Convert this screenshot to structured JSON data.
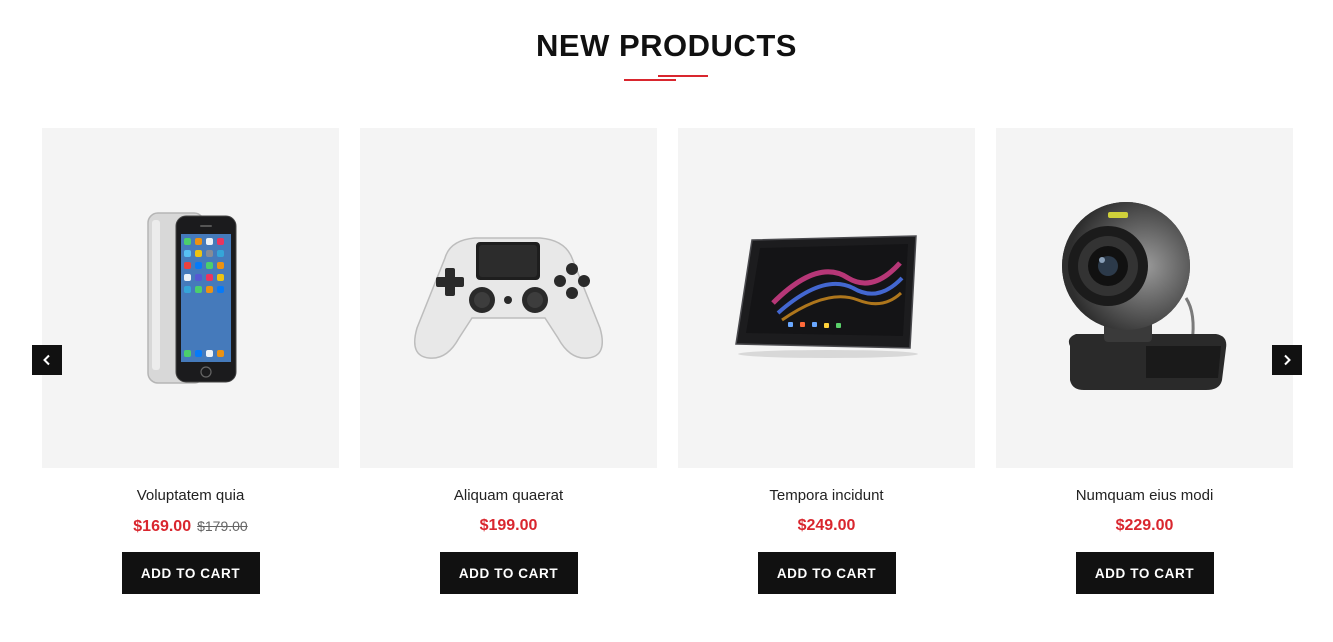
{
  "section": {
    "title": "NEW PRODUCTS"
  },
  "products": [
    {
      "name": "Voluptatem quia",
      "price": "$169.00",
      "old_price": "$179.00",
      "button": "ADD TO CART",
      "image": "smartphone-image"
    },
    {
      "name": "Aliquam quaerat",
      "price": "$199.00",
      "old_price": "",
      "button": "ADD TO CART",
      "image": "game-controller-image"
    },
    {
      "name": "Tempora incidunt",
      "price": "$249.00",
      "old_price": "",
      "button": "ADD TO CART",
      "image": "tablet-image"
    },
    {
      "name": "Numquam eius modi",
      "price": "$229.00",
      "old_price": "",
      "button": "ADD TO CART",
      "image": "webcam-image"
    }
  ],
  "navigation": {
    "prev_icon": "chevron-left-icon",
    "next_icon": "chevron-right-icon"
  },
  "colors": {
    "accent": "#d9262e",
    "button_bg": "#111111",
    "card_bg": "#f4f4f4"
  }
}
